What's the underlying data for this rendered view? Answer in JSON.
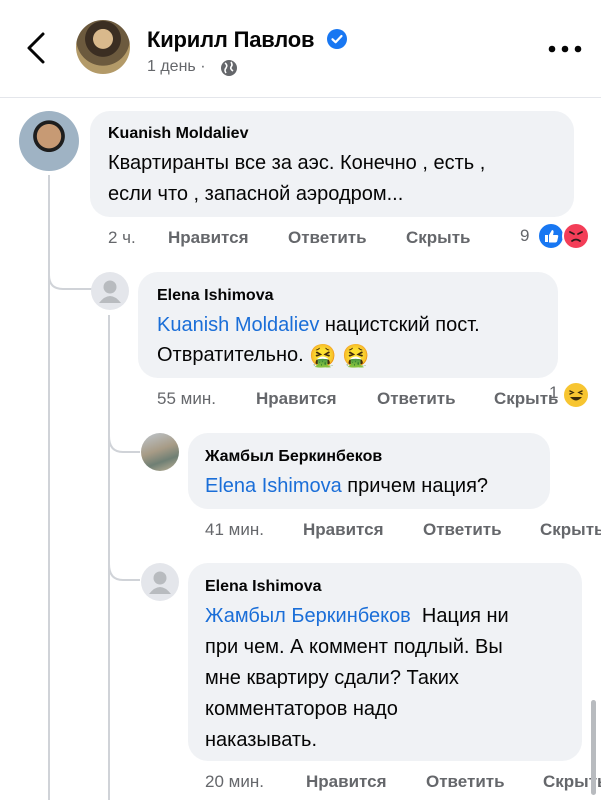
{
  "header": {
    "name": "Кирилл Павлов",
    "meta": "1 день ·"
  },
  "comments": [
    {
      "author": "Kuanish Moldaliev",
      "lines": [
        "Квартиранты все за аэс. Конечно , есть ,",
        "если что , запасной аэродром..."
      ],
      "time": "2 ч.",
      "like": "Нравится",
      "reply": "Ответить",
      "hide": "Скрыть",
      "reactions_count": "9"
    },
    {
      "author": "Elena Ishimova",
      "mention": "Kuanish Moldaliev",
      "line1_rest": " нацистский пост.",
      "line2": "Отвратительно. ",
      "emoji": "🤮",
      "time": "55 мин.",
      "like": "Нравится",
      "reply": "Ответить",
      "hide": "Скрыть",
      "reactions_count": "1"
    },
    {
      "author": "Жамбыл Беркинбеков",
      "mention": "Elena Ishimova",
      "line1_rest": " причем нация?",
      "time": "41 мин.",
      "like": "Нравится",
      "reply": "Ответить",
      "hide": "Скрыть"
    },
    {
      "author": "Elena Ishimova",
      "mention": "Жамбыл Беркинбеков",
      "line1_rest": "  Нация ни",
      "lines": [
        "при чем. А коммент подлый. Вы",
        "мне квартиру сдали? Таких",
        "комментаторов надо",
        "наказывать."
      ],
      "time": "20 мин.",
      "like": "Нравится",
      "reply": "Ответить",
      "hide": "Скрыть"
    }
  ],
  "colors": {
    "bubble": "#f0f2f5",
    "mention": "#1a6ed8",
    "meta": "#65676b",
    "like_blue": "#1877f2",
    "angry": "#f33e58"
  }
}
